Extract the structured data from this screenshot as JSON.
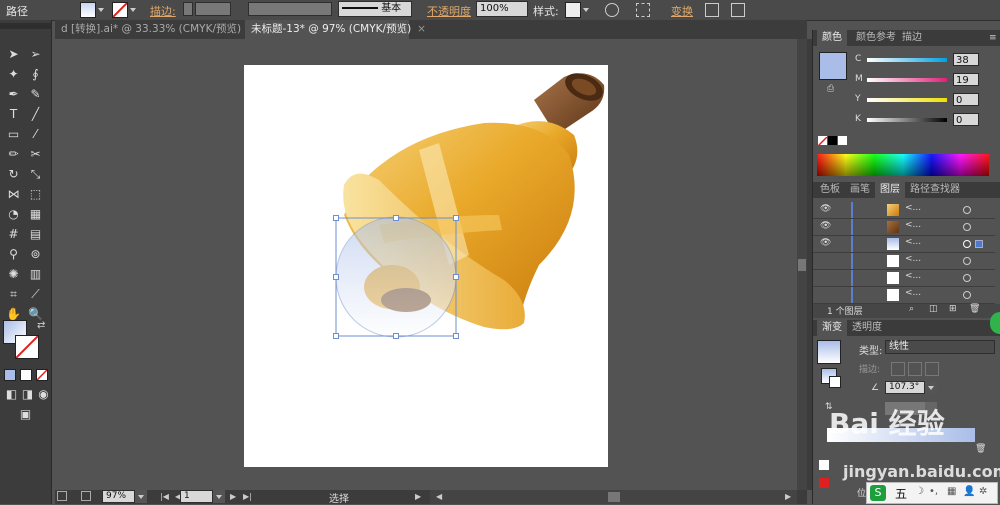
{
  "control_bar": {
    "object_type": "路径",
    "stroke_label": "描边:",
    "stroke_profile": "基本",
    "opacity_label": "不透明度",
    "opacity_value": "100%",
    "style_label": "样式:",
    "transform_label": "变换"
  },
  "document_tabs": [
    {
      "label": "d [转换].ai* @ 33.33% (CMYK/预览)",
      "active": false
    },
    {
      "label": "未标题-13* @ 97% (CMYK/预览)",
      "active": true
    }
  ],
  "color_panel": {
    "tabs": [
      "颜色",
      "颜色参考",
      "描边"
    ],
    "channels": [
      {
        "name": "C",
        "value": "38"
      },
      {
        "name": "M",
        "value": "19"
      },
      {
        "name": "Y",
        "value": "0"
      },
      {
        "name": "K",
        "value": "0"
      }
    ],
    "fill_color": "#a9bde8"
  },
  "layers_panel": {
    "tabs": [
      "色板",
      "画笔",
      "图层",
      "路径查找器"
    ],
    "rows": [
      {
        "name": "<...",
        "visible": true
      },
      {
        "name": "<...",
        "visible": true
      },
      {
        "name": "<...",
        "visible": true
      },
      {
        "name": "<...",
        "visible": false
      },
      {
        "name": "<...",
        "visible": false
      },
      {
        "name": "<...",
        "visible": false
      }
    ],
    "footer": "1 个图层"
  },
  "gradient_panel": {
    "tabs": [
      "渐变",
      "透明度"
    ],
    "type_label": "类型:",
    "type_value": "线性",
    "stroke_label": "描边:",
    "angle_value": "107.3°",
    "location_label": "位置"
  },
  "status_bar": {
    "zoom": "97%",
    "page": "1",
    "mode": "选择"
  },
  "watermark": {
    "text": "Bai 经验",
    "url": "jingyan.baidu.com"
  },
  "taskbar_ime": {
    "label": "五"
  }
}
